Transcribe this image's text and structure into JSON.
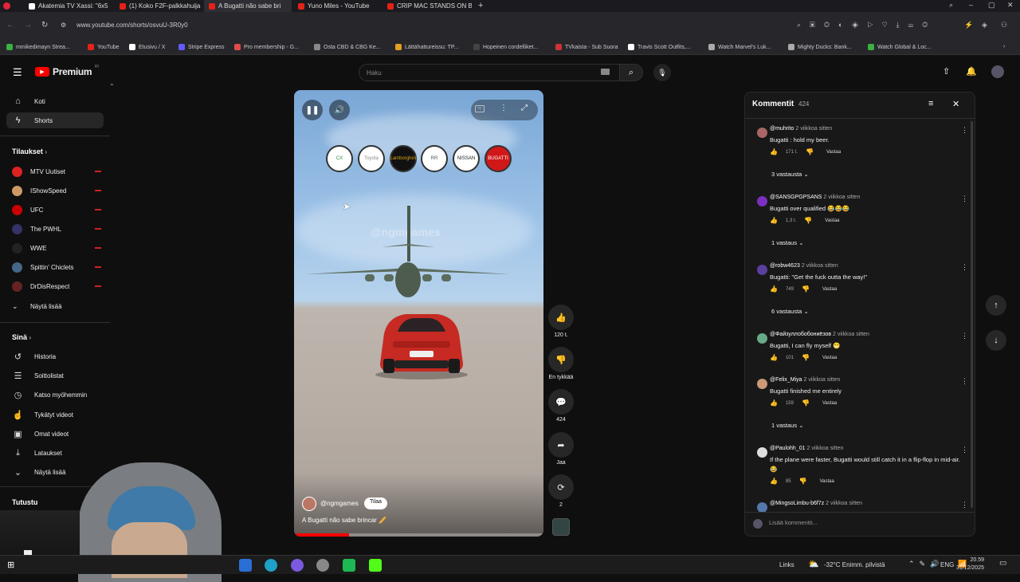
{
  "browser": {
    "tabs": [
      {
        "label": "Akatemia TV Xassi: \"6x5",
        "color": "#111"
      },
      {
        "label": "(1) Koko F2F-palkkahuija",
        "color": "#e62117"
      },
      {
        "label": "A Bugatti não sabe bri",
        "color": "#e62117"
      },
      {
        "label": "Yuno Miles - YouTube",
        "color": "#e62117"
      },
      {
        "label": "CRIP MAC STANDS ON BU",
        "color": "#e62117"
      }
    ],
    "url": "www.youtube.com/shorts/osvuU-3R0y0",
    "bookmarks": [
      {
        "label": "mmikedimayn Strea...",
        "color": "#3cb043"
      },
      {
        "label": "YouTube",
        "color": "#e62117"
      },
      {
        "label": "Etusivu / X",
        "color": "#fff"
      },
      {
        "label": "Stripe Express",
        "color": "#635bff"
      },
      {
        "label": "Pro membership - G...",
        "color": "#e24a4a"
      },
      {
        "label": "Osta CBD & CBG Ke...",
        "color": "#888"
      },
      {
        "label": "Lättähattureissu: TP...",
        "color": "#e0a020"
      },
      {
        "label": "Hopeinen cordelliket...",
        "color": "#444"
      },
      {
        "label": "TVkaista - Sub Suora",
        "color": "#c33"
      },
      {
        "label": "Travis Scott Outfits,...",
        "color": "#fff"
      },
      {
        "label": "Watch Marvel's Luk...",
        "color": "#aaa"
      },
      {
        "label": "Mighty Ducks: Bank...",
        "color": "#aaa"
      },
      {
        "label": "Watch Global & Loc...",
        "color": "#3cb043"
      }
    ]
  },
  "header": {
    "logo": "Premium",
    "logo_sup": "FI",
    "search_placeholder": "Haku"
  },
  "sidebar": {
    "main": [
      {
        "label": "Koti",
        "icon": "home-icon",
        "glyph": "⌂"
      },
      {
        "label": "Shorts",
        "icon": "shorts-icon",
        "glyph": "▶"
      }
    ],
    "subs_title": "Tilaukset",
    "subs": [
      {
        "label": "MTV Uutiset",
        "color": "#d22"
      },
      {
        "label": "IShowSpeed",
        "color": "#c96"
      },
      {
        "label": "UFC",
        "color": "#c00"
      },
      {
        "label": "The PWHL",
        "color": "#336"
      },
      {
        "label": "WWE",
        "color": "#222"
      },
      {
        "label": "Spittin' Chiclets",
        "color": "#468"
      },
      {
        "label": "DrDisRespect",
        "color": "#622"
      }
    ],
    "show_more": "Näytä lisää",
    "you_title": "Sinä",
    "you": [
      {
        "label": "Historia",
        "icon": "history-icon",
        "glyph": "↺"
      },
      {
        "label": "Soittolistat",
        "icon": "playlists-icon",
        "glyph": "☰"
      },
      {
        "label": "Katso myöhemmin",
        "icon": "watch-later-icon",
        "glyph": "◷"
      },
      {
        "label": "Tykätyt videot",
        "icon": "liked-icon",
        "glyph": "👍"
      },
      {
        "label": "Omat videot",
        "icon": "your-videos-icon",
        "glyph": "▣"
      },
      {
        "label": "Lataukset",
        "icon": "downloads-icon",
        "glyph": "⤓"
      }
    ],
    "show_more_2": "Näytä lisää",
    "explore_title": "Tutustu"
  },
  "video": {
    "watermark": "@ngmgames",
    "channel": "@ngmgames",
    "subscribe": "Tilaa",
    "title": "A Bugatti não sabe brincar 🥖",
    "brands": [
      "CX",
      "Toyota",
      "Lamborghini",
      "RR",
      "NISSAN",
      "BUGATTI"
    ]
  },
  "actions": {
    "likes": "120 t.",
    "dislike": "En tykkää",
    "comments": "424",
    "share": "Jaa",
    "remix": "2"
  },
  "comments": {
    "title": "Kommentit",
    "count": "424",
    "add_placeholder": "Lisää kommentti...",
    "reply_label": "Vastaa",
    "items": [
      {
        "user": "@muhrito",
        "ago": "2 viikkoa sitten",
        "text": "Bugatti : hold my beer.",
        "likes": "171 t.",
        "replies": "3 vastausta",
        "av": "#a66"
      },
      {
        "user": "@SANSGPGPSANS",
        "ago": "2 viikkoa sitten",
        "text": "Bugatti over qualified 😂😂😂",
        "likes": "1,3 t.",
        "replies": "1 vastaus",
        "av": "#7b2fbf"
      },
      {
        "user": "@robw4623",
        "ago": "2 viikkoa sitten",
        "text": "Bugatti: \"Get the fuck outta the way!\"",
        "likes": "749",
        "replies": "6 vastausta",
        "av": "#5a3fa0"
      },
      {
        "user": "@Файзуллобобониёзов",
        "ago": "2 viikkoa sitten",
        "text": "Bugatti, I can fly myself 😁",
        "likes": "101",
        "replies": "",
        "av": "#6a8"
      },
      {
        "user": "@Felix_Miya",
        "ago": "2 viikkoa sitten",
        "text": "Bugatti finished me entirely",
        "likes": "159",
        "replies": "1 vastaus",
        "av": "#c97"
      },
      {
        "user": "@Paulohh_01",
        "ago": "2 viikkoa sitten",
        "text": "If the plane were faster, Bugatti would still catch it in a flip-flop in mid-air. 😂",
        "likes": "85",
        "replies": "",
        "av": "#ddd"
      },
      {
        "user": "@MingsoLimbu-b6f7z",
        "ago": "2 viikkoa sitten",
        "text": "",
        "likes": "",
        "replies": "",
        "av": "#57a"
      }
    ]
  },
  "taskbar": {
    "links": "Links",
    "weather": "-32°C  Enimm. pilvistä",
    "lang": "ENG",
    "time": "20.59",
    "date": "31/12/2025"
  }
}
